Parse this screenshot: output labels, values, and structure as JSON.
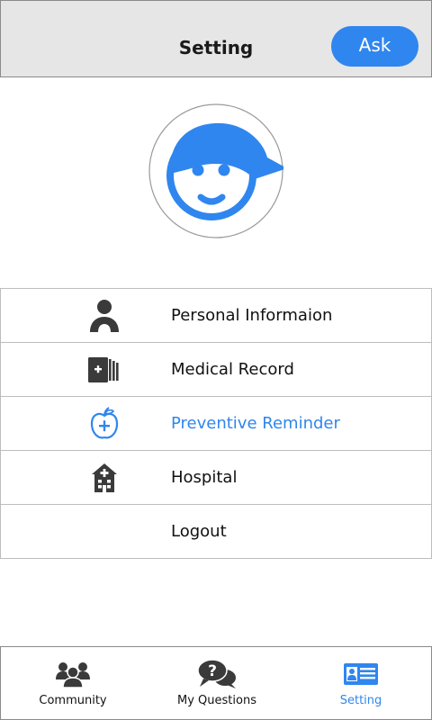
{
  "header": {
    "title": "Setting",
    "ask_label": "Ask"
  },
  "colors": {
    "accent": "#2f86ee",
    "icon_dark": "#3a3a3a",
    "header_bg": "#e6e6e6"
  },
  "profile": {
    "avatar_icon": "user-avatar-icon"
  },
  "menu": {
    "items": [
      {
        "label": "Personal Informaion",
        "icon": "person-icon"
      },
      {
        "label": "Medical Record",
        "icon": "medical-record-icon"
      },
      {
        "label": "Preventive Reminder",
        "icon": "apple-plus-icon",
        "active": true
      },
      {
        "label": "Hospital",
        "icon": "hospital-icon"
      },
      {
        "label": "Logout",
        "icon": ""
      }
    ]
  },
  "tabbar": {
    "tabs": [
      {
        "label": "Community",
        "icon": "community-icon"
      },
      {
        "label": "My Questions",
        "icon": "question-bubble-icon"
      },
      {
        "label": "Setting",
        "icon": "setting-card-icon",
        "active": true
      }
    ]
  }
}
